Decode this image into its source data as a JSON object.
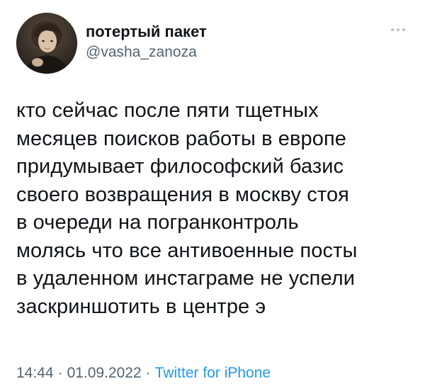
{
  "author": {
    "display_name": "потертый пакет",
    "handle": "@vasha_zanoza"
  },
  "icons": {
    "more": "more-horizontal-icon"
  },
  "tweet": {
    "lines": [
      "кто сейчас после пяти тщетных",
      "месяцев поисков работы в европе",
      "придумывает философский базис",
      "своего возвращения в москву стоя",
      "в очереди на погранконтроль",
      "молясь что все антивоенные посты",
      "в удаленном инстаграме не успели",
      "заскриншотить в центре э"
    ]
  },
  "meta": {
    "time": "14:44",
    "separator": "·",
    "date": "01.09.2022",
    "source": "Twitter for iPhone"
  },
  "colors": {
    "text": "#0f1419",
    "secondary": "#536471",
    "link": "#1d9bf0"
  }
}
